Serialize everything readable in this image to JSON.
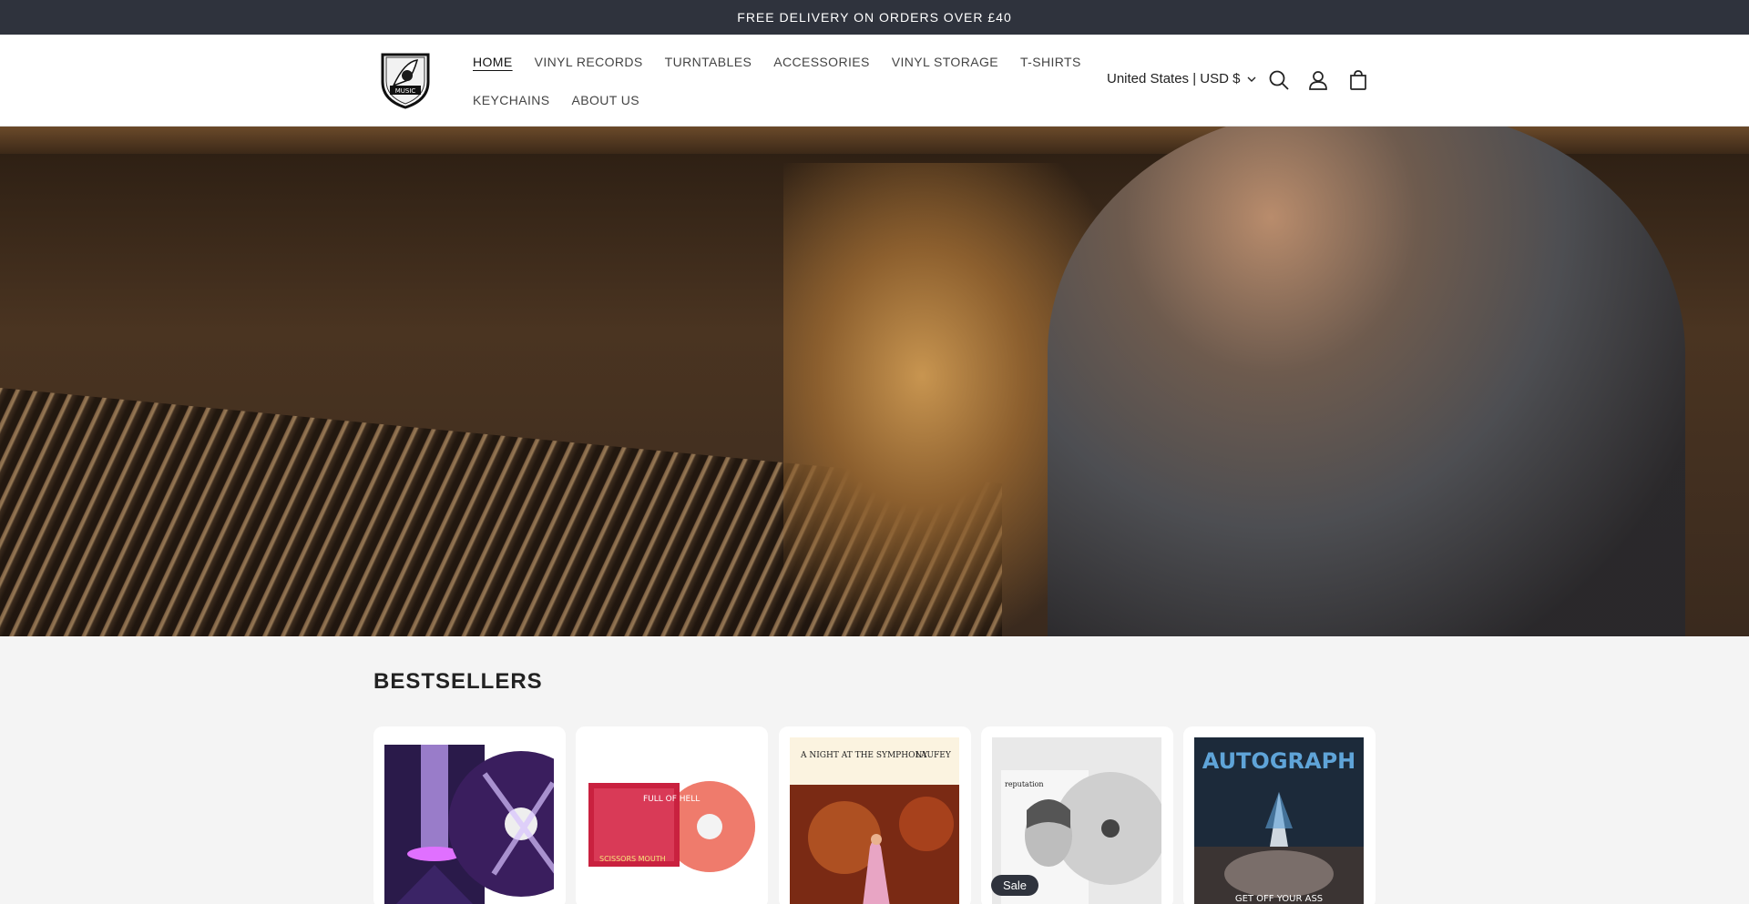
{
  "announcement": "FREE DELIVERY ON ORDERS OVER £40",
  "logo": {
    "text": "MUSIC"
  },
  "nav": {
    "row1": [
      "HOME",
      "VINYL RECORDS",
      "TURNTABLES",
      "ACCESSORIES",
      "VINYL STORAGE",
      "T-SHIRTS"
    ],
    "row2": [
      "KEYCHAINS",
      "ABOUT US"
    ],
    "active": "HOME"
  },
  "country_selector": "United States | USD $",
  "icons": [
    "search-icon",
    "account-icon",
    "cart-icon"
  ],
  "bestsellers": {
    "heading": "BESTSELLERS",
    "products": [
      {
        "cover_text": ""
      },
      {
        "cover_text": "FULL OF HELL",
        "sub_text": "SCISSORS MOUTH"
      },
      {
        "cover_text": "A NIGHT AT THE SYMPHONY",
        "artist": "LAUFEY"
      },
      {
        "cover_text": "reputation",
        "badge": "Sale"
      },
      {
        "cover_text": "AUTOGRAPH",
        "sub_text": "GET OFF YOUR ASS"
      }
    ]
  },
  "colors": {
    "announcement_bg": "#2f333d",
    "page_bg": "#f4f4f4",
    "badge_bg": "#2f333d"
  }
}
